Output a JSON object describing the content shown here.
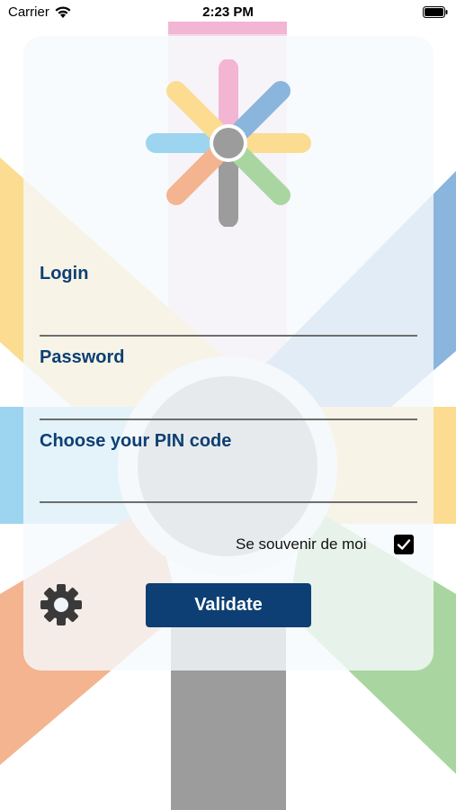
{
  "status_bar": {
    "carrier": "Carrier",
    "time": "2:23 PM"
  },
  "form": {
    "login_label": "Login",
    "login_value": "",
    "password_label": "Password",
    "password_value": "",
    "pin_label": "Choose your PIN code",
    "pin_value": ""
  },
  "remember_me": {
    "label": "Se souvenir de moi",
    "checked": true
  },
  "validate_label": "Validate",
  "colors": {
    "primary": "#0d3f74",
    "pink": "#f3b5d4",
    "blue": "#8ab5dc",
    "yellow": "#fbdc91",
    "cyan": "#9dd4ef",
    "orange": "#f3b48f",
    "green": "#a9d6a0",
    "grey": "#9c9c9c"
  },
  "icons": [
    "wifi-icon",
    "battery-icon",
    "logo-icon",
    "settings-gear-icon",
    "checkmark-icon"
  ]
}
